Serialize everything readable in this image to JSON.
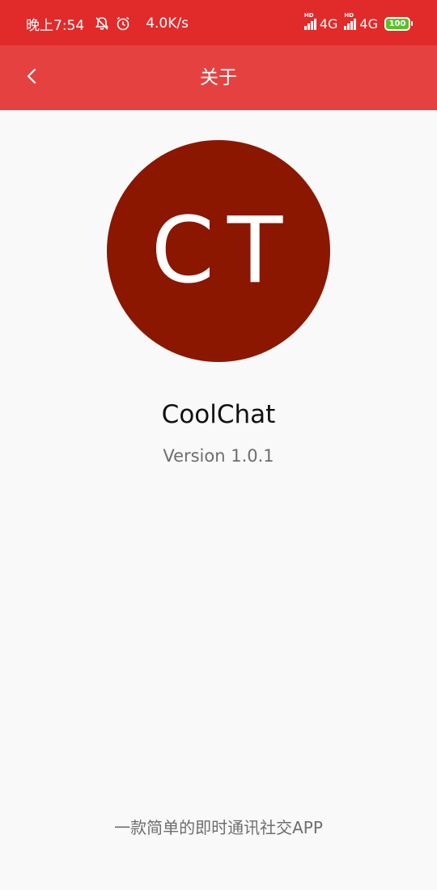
{
  "status_bar": {
    "time": "晚上7:54",
    "net_speed": "4.0K/s",
    "sim1_label": "4G",
    "sim2_label": "4G",
    "battery": "100",
    "background": "#e12a2a"
  },
  "app_bar": {
    "title": "关于",
    "background": "#e54141",
    "back_icon": "chevron-left-icon"
  },
  "about": {
    "logo_text": "CT",
    "logo_color": "#8b1700",
    "app_name": "CoolChat",
    "version": "Version 1.0.1",
    "description": "一款简单的即时通讯社交APP"
  }
}
